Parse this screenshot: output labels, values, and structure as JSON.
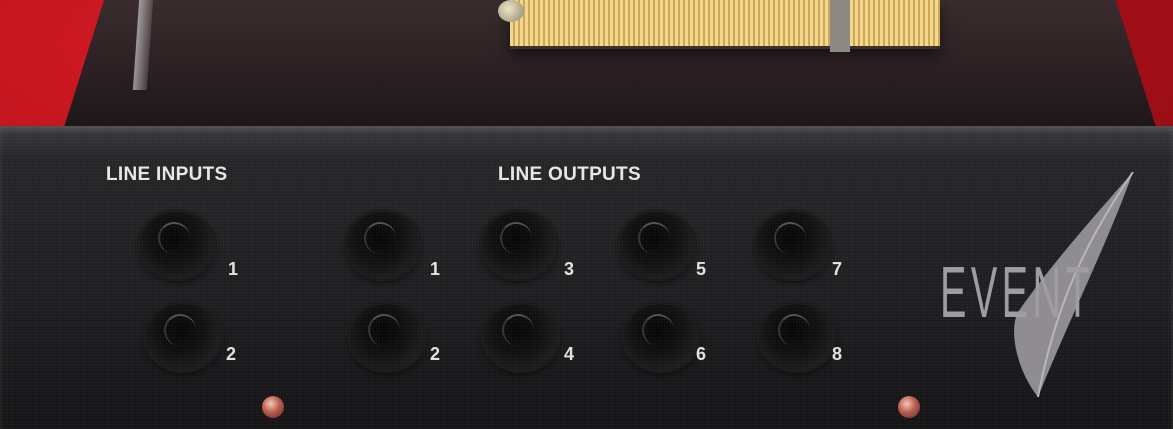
{
  "panel": {
    "inputs_label": "LINE INPUTS",
    "outputs_label": "LINE OUTPUTS",
    "input_numbers": [
      "1",
      "2"
    ],
    "output_numbers": [
      "1",
      "2",
      "3",
      "4",
      "5",
      "6",
      "7",
      "8"
    ],
    "brand": "EVENT"
  },
  "colors": {
    "background_red": "#b8121d",
    "panel_black": "#1d1c1f",
    "label_white": "#e9e6e4"
  }
}
